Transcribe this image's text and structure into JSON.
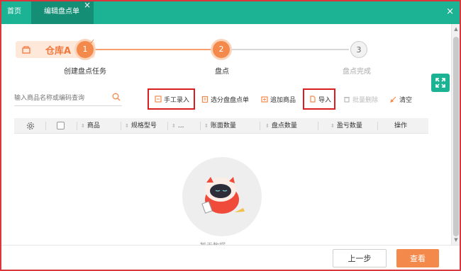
{
  "tabs": {
    "home": "首页",
    "edit": "编辑盘点单",
    "close": "×"
  },
  "window_close": "×",
  "warehouse": {
    "label": "仓库A"
  },
  "steps": [
    {
      "num": "1",
      "label": "创建盘点任务"
    },
    {
      "num": "2",
      "label": "盘点"
    },
    {
      "num": "3",
      "label": "盘点完成"
    }
  ],
  "search": {
    "placeholder": "输入商品名称或编码查询"
  },
  "toolbar": {
    "manual": "手工录入",
    "select": "选分盘盘点单",
    "add": "追加商品",
    "import": "导入",
    "batch": "批量删除",
    "clear": "清空"
  },
  "table": {
    "headers": [
      "商品",
      "规格型号",
      "...",
      "账面数量",
      "盘点数量",
      "盈亏数量",
      "操作"
    ]
  },
  "empty_text": "暂无数据",
  "footer": {
    "prev": "上一步",
    "view": "查看"
  },
  "colors": {
    "accent_green": "#1bb394",
    "accent_orange": "#f38a4b",
    "highlight_red": "#d81e1e"
  }
}
